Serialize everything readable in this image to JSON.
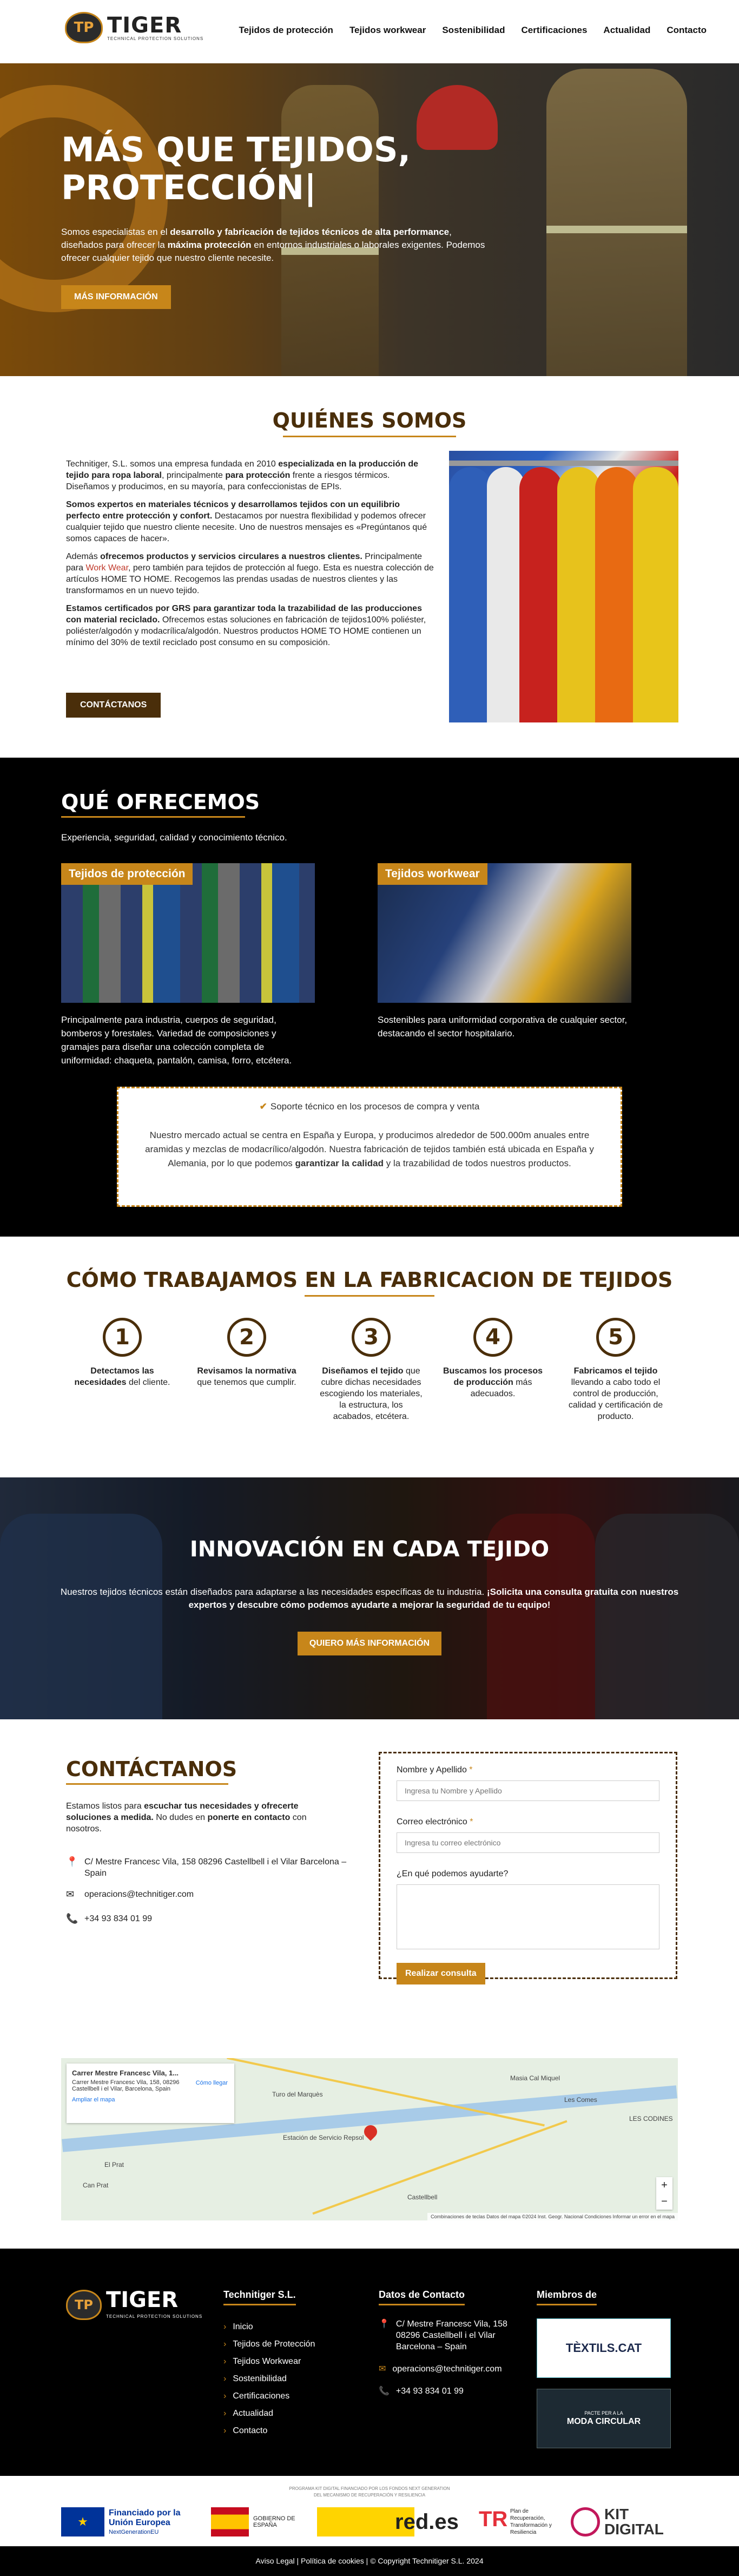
{
  "header": {
    "logo_mark": "TP",
    "logo_name": "TIGER",
    "logo_tagline": "TECHNICAL PROTECTION SOLUTIONS",
    "nav": [
      "Tejidos de protección",
      "Tejidos workwear",
      "Sostenibilidad",
      "Certificaciones",
      "Actualidad",
      "Contacto"
    ]
  },
  "hero": {
    "title_line1": "MÁS QUE TEJIDOS,",
    "title_line2": "PROTECCIÓN|",
    "text_a": "Somos especialistas en el ",
    "text_b": "desarrollo y fabricación de tejidos técnicos de alta performance",
    "text_c": ", diseñados para ofrecer la ",
    "text_d": "máxima protección",
    "text_e": " en entornos industriales o laborales exigentes. Podemos ofrecer cualquier tejido que nuestro cliente necesite.",
    "button": "MÁS INFORMACIÓN"
  },
  "quienes": {
    "title": "QUIÉNES SOMOS",
    "p1a": "Technitiger, S.L. somos una empresa fundada en 2010 ",
    "p1b": "especializada en la producción de tejido para ropa laboral",
    "p1c": ", principalmente ",
    "p1d": "para protección",
    "p1e": " frente a riesgos térmicos. Diseñamos y producimos, en su mayoría, para confeccionistas de EPIs.",
    "p2a": "Somos expertos en materiales técnicos y desarrollamos tejidos con un equilibrio perfecto entre protección y confort.",
    "p2b": " Destacamos por nuestra flexibilidad y podemos ofrecer cualquier tejido que nuestro cliente necesite. Uno de nuestros mensajes es «Pregúntanos qué somos capaces de hacer».",
    "p3a": "Además ",
    "p3b": "ofrecemos productos y servicios circulares a nuestros clientes.",
    "p3c": " Principalmente para ",
    "p3d": "Work Wear",
    "p3e": ", pero también para tejidos de protección al fuego. Esta es nuestra colección de artículos HOME TO HOME. Recogemos las prendas usadas de nuestros clientes y las transformamos en un nuevo tejido.",
    "p4a": "Estamos certificados por GRS para garantizar toda la trazabilidad de las producciones con material reciclado.",
    "p4b": " Ofrecemos estas soluciones en fabricación de tejidos100% poliéster, poliéster/algodón y modacrílica/algodón. Nuestros productos HOME TO HOME contienen un mínimo del 30% de textil reciclado post consumo en su composición.",
    "button": "CONTÁCTANOS"
  },
  "ofrecemos": {
    "title": "QUÉ OFRECEMOS",
    "subtitle": "Experiencia, seguridad, calidad y conocimiento técnico.",
    "cards": [
      {
        "label": "Tejidos de protección",
        "desc": "Principalmente para industria, cuerpos de seguridad, bomberos y forestales. Variedad de composiciones y gramajes para diseñar una colección completa de uniformidad: chaqueta, pantalón, camisa, forro, etcétera."
      },
      {
        "label": "Tejidos workwear",
        "desc": "Sostenibles para uniformidad corporativa de cualquier sector, destacando el sector hospitalario."
      }
    ],
    "support_title": "Soporte técnico en los procesos de compra y venta",
    "support_a": "Nuestro mercado actual se centra en España y Europa, y producimos alrededor de 500.000m anuales entre aramidas y mezclas de modacrílico/algodón. Nuestra fabricación de tejidos también está ubicada en España y Alemania, por lo que podemos ",
    "support_b": "garantizar la calidad",
    "support_c": " y la trazabilidad de todos nuestros productos."
  },
  "como": {
    "title": "CÓMO TRABAJAMOS EN LA FABRICACION DE TEJIDOS",
    "steps": [
      {
        "num": "1",
        "a": "Detectamos las necesidades",
        "b": " del cliente."
      },
      {
        "num": "2",
        "a": "Revisamos la normativa",
        "b": " que tenemos que cumplir."
      },
      {
        "num": "3",
        "a": "Diseñamos el tejido",
        "b": " que cubre dichas necesidades escogiendo los materiales, la estructura, los acabados, etcétera."
      },
      {
        "num": "4",
        "a": "Buscamos los procesos de producción",
        "b": " más adecuados."
      },
      {
        "num": "5",
        "a": "Fabricamos el tejido",
        "b": " llevando a cabo todo el control de producción, calidad y certificación de producto."
      }
    ]
  },
  "innovacion": {
    "title": "INNOVACIÓN EN CADA TEJIDO",
    "text_a": "Nuestros tejidos técnicos están diseñados para adaptarse a las necesidades específicas de tu industria. ",
    "text_b": "¡Solicita una consulta gratuita con nuestros expertos y descubre cómo podemos ayudarte a mejorar la seguridad de tu equipo!",
    "button": "QUIERO MÁS INFORMACIÓN"
  },
  "contacto": {
    "title": "CONTÁCTANOS",
    "intro_a": "Estamos listos para ",
    "intro_b": "escuchar tus necesidades y ofrecerte soluciones a medida.",
    "intro_c": " No dudes en ",
    "intro_d": "ponerte en contacto",
    "intro_e": " con nosotros.",
    "address": "C/ Mestre Francesc Vila, 158 08296 Castellbell i el Vilar Barcelona – Spain",
    "email": "operacions@technitiger.com",
    "phone": "+34 93 834 01 99",
    "form": {
      "name_label": "Nombre y Apellido",
      "name_placeholder": "Ingresa tu Nombre y Apellido",
      "email_label": "Correo electrónico",
      "email_placeholder": "Ingresa tu correo electrónico",
      "msg_label": "¿En qué podemos ayudarte?",
      "required_mark": "*",
      "submit": "Realizar consulta"
    }
  },
  "map": {
    "card_title": "Carrer Mestre Francesc Vila, 1...",
    "card_addr": "Carrer Mestre Francesc Vila, 158, 08296 Castellbell i el Vilar, Barcelona, Spain",
    "directions": "Cómo llegar",
    "enlarge": "Ampliar el mapa",
    "towns": [
      "Turo del Marquès",
      "Estación de Servicio Repsol",
      "Castellbell",
      "El Prat",
      "Can Prat",
      "Les Comes",
      "Masia Cal Miquel",
      "LES CODINES"
    ],
    "zoom_in": "+",
    "zoom_out": "−",
    "attribution": "Combinaciones de teclas   Datos del mapa ©2024 Inst. Geogr. Nacional   Condiciones   Informar un error en el mapa"
  },
  "footer": {
    "col1_title": "Technitiger S.L.",
    "links": [
      "Inicio",
      "Tejidos de Protección",
      "Tejidos Workwear",
      "Sostenibilidad",
      "Certificaciones",
      "Actualidad",
      "Contacto"
    ],
    "col2_title": "Datos de Contacto",
    "address": "C/ Mestre Francesc Vila, 158 08296 Castellbell i el Vilar Barcelona – Spain",
    "email": "operacions@technitiger.com",
    "phone": "+34 93 834 01 99",
    "col3_title": "Miembros de",
    "member1": "TÈXTILS.CAT",
    "member2": "MODA CIRCULAR",
    "member2_top": "PACTE PER A LA",
    "funding_line1": "PROGRAMA KIT DIGITAL FINANCIADO POR LOS FONDOS NEXT GENERATION",
    "funding_line2": "DEL MECANISMO DE RECUPERACIÓN Y RESILIENCIA",
    "eu": "Financiado por la Unión Europea",
    "eu_sub": "NextGenerationEU",
    "gob": "GOBIERNO DE ESPAÑA",
    "reds": "red.es",
    "plan": "Plan de Recuperación, Transformación y Resiliencia",
    "kit": "KIT DIGITAL",
    "bottom": "Aviso Legal | Política de cookies | © Copyright Technitiger S.L. 2024"
  }
}
